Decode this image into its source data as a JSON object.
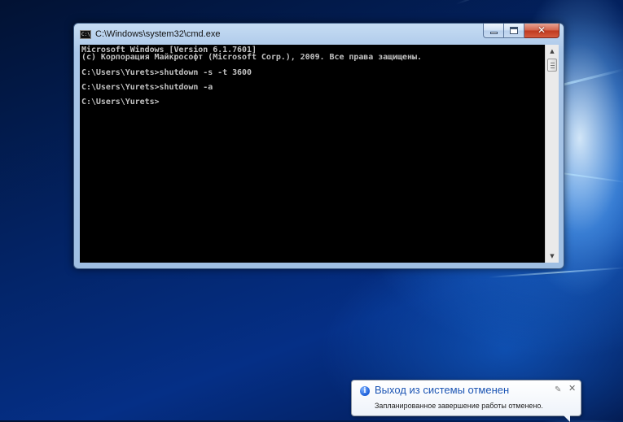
{
  "window": {
    "title": "C:\\Windows\\system32\\cmd.exe",
    "icon": "console-app-icon",
    "icon_glyph": "C:\\",
    "close_glyph": "✕"
  },
  "console": {
    "lines": [
      "Microsoft Windows [Version 6.1.7601]",
      "(c) Корпорация Майкрософт (Microsoft Corp.), 2009. Все права защищены.",
      "",
      "C:\\Users\\Yurets>shutdown -s -t 3600",
      "",
      "C:\\Users\\Yurets>shutdown -a",
      "",
      "C:\\Users\\Yurets>"
    ]
  },
  "scrollbar": {
    "up_glyph": "▲",
    "down_glyph": "▼"
  },
  "notification": {
    "icon": "info-icon",
    "icon_glyph": "i",
    "title": "Выход из системы отменен",
    "body": "Запланированное завершение работы отменено.",
    "pin_glyph": "✎",
    "close_glyph": "✕"
  },
  "colors": {
    "console_bg": "#000000",
    "console_text": "#c0c0c0",
    "balloon_title": "#1c55b4",
    "close_button": "#c0391f"
  }
}
